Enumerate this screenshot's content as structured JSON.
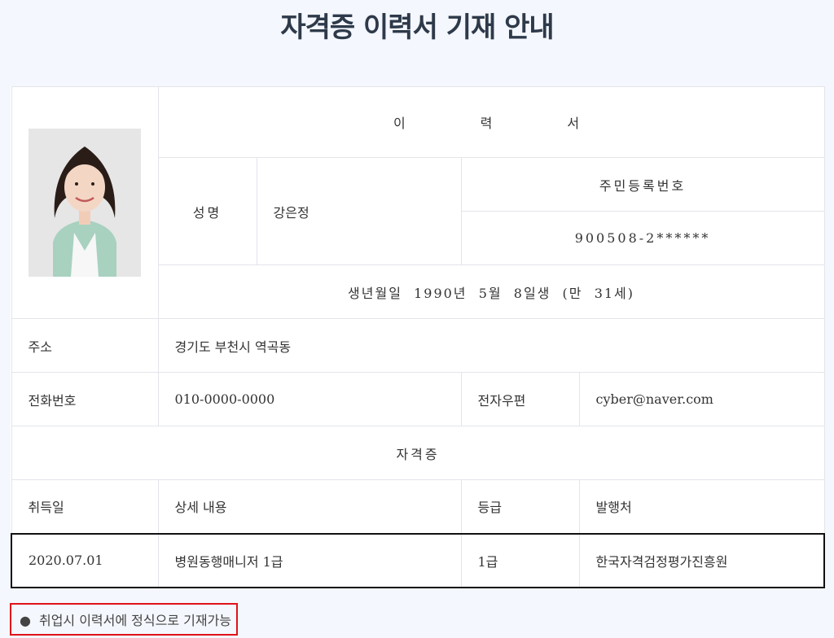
{
  "page_title": "자격증 이력서 기재 안내",
  "resume": {
    "title": "이력서",
    "name_label": "성명",
    "name_value": "강은정",
    "rrn_label": "주민등록번호",
    "rrn_value": "900508-2******",
    "birth_text": "생년월일  1990년  5월  8일생  (만  31세)",
    "address_label": "주소",
    "address_value": "경기도 부천시 역곡동",
    "phone_label": "전화번호",
    "phone_value": "010-0000-0000",
    "email_label": "전자우편",
    "email_value": "cyber@naver.com",
    "cert_section_label": "자격증",
    "cert_headers": [
      "취득일",
      "상세 내용",
      "등급",
      "발행처"
    ],
    "cert_rows": [
      {
        "date": "2020.07.01",
        "detail": "병원동행매니저 1급",
        "grade": "1급",
        "issuer": "한국자격검정평가진흥원"
      }
    ]
  },
  "note": "취업시 이력서에 정식으로 기재가능",
  "colors": {
    "highlight_border": "#111111",
    "note_border": "#e0121a",
    "background": "#f4f7fd"
  }
}
